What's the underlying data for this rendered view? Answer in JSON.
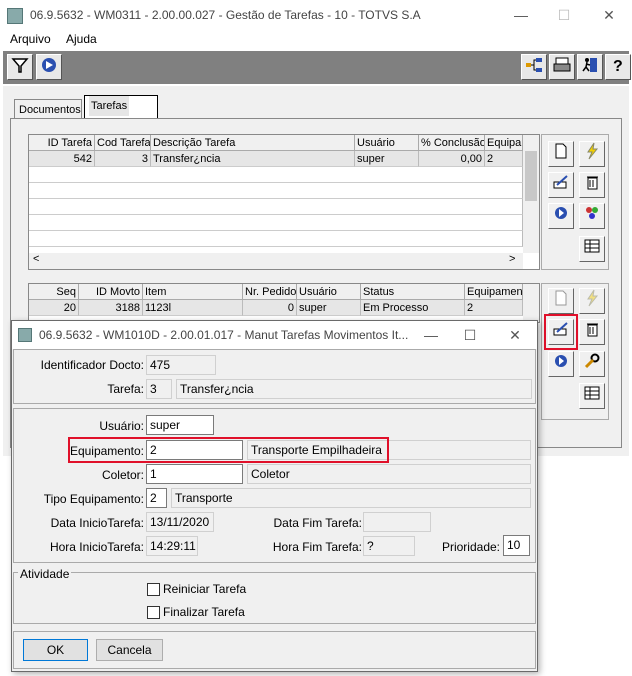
{
  "main_window": {
    "title": "06.9.5632 - WM0311 - 2.00.00.027 - Gestão de Tarefas - 10 - TOTVS S.A",
    "controls": {
      "minimize": "—",
      "maximize": "☐",
      "close": "✕"
    },
    "menu": [
      "Arquivo",
      "Ajuda"
    ],
    "tabs": [
      "Documentos",
      "Tarefas"
    ],
    "tasks_grid": {
      "columns": [
        "ID Tarefa",
        "Cod Tarefa",
        "Descrição Tarefa",
        "Usuário",
        "% Conclusão",
        "Equipar"
      ],
      "rows": [
        [
          "542",
          "3",
          "Transfer¿ncia",
          "super",
          "0,00",
          "2"
        ]
      ]
    },
    "movements_grid": {
      "columns": [
        "Seq",
        "ID Movto",
        "Item",
        "Nr. Pedido",
        "Usuário",
        "Status",
        "Equipament"
      ],
      "rows": [
        [
          "20",
          "3188",
          "1123l",
          "0",
          "super",
          "Em Processo",
          "2"
        ]
      ]
    }
  },
  "dialog": {
    "title": "06.9.5632 - WM1010D - 2.00.01.017 - Manut Tarefas Movimentos It...",
    "controls": {
      "minimize": "—",
      "maximize": "☐",
      "close": "✕"
    },
    "identificador_label": "Identificador Docto:",
    "identificador_value": "475",
    "tarefa_label": "Tarefa:",
    "tarefa_code": "3",
    "tarefa_desc": "Transfer¿ncia",
    "usuario_label": "Usuário:",
    "usuario_value": "super",
    "equipamento_label": "Equipamento:",
    "equipamento_code": "2",
    "equipamento_desc": "Transporte Empilhadeira",
    "coletor_label": "Coletor:",
    "coletor_code": "1",
    "coletor_desc": "Coletor",
    "tipo_label": "Tipo Equipamento:",
    "tipo_code": "2",
    "tipo_desc": "Transporte",
    "data_inicio_label": "Data InicioTarefa:",
    "data_inicio_value": "13/11/2020",
    "data_fim_label": "Data Fim Tarefa:",
    "data_fim_value": "",
    "hora_inicio_label": "Hora InicioTarefa:",
    "hora_inicio_value": "14:29:11",
    "hora_fim_label": "Hora Fim Tarefa:",
    "hora_fim_value": "?",
    "prioridade_label": "Prioridade:",
    "prioridade_value": "10",
    "atividade_label": "Atividade",
    "reiniciar_label": "Reiniciar Tarefa",
    "finalizar_label": "Finalizar Tarefa",
    "ok_label": "OK",
    "cancela_label": "Cancela"
  },
  "colors": {
    "highlight": "#e0102a",
    "toolbar": "#808080"
  }
}
